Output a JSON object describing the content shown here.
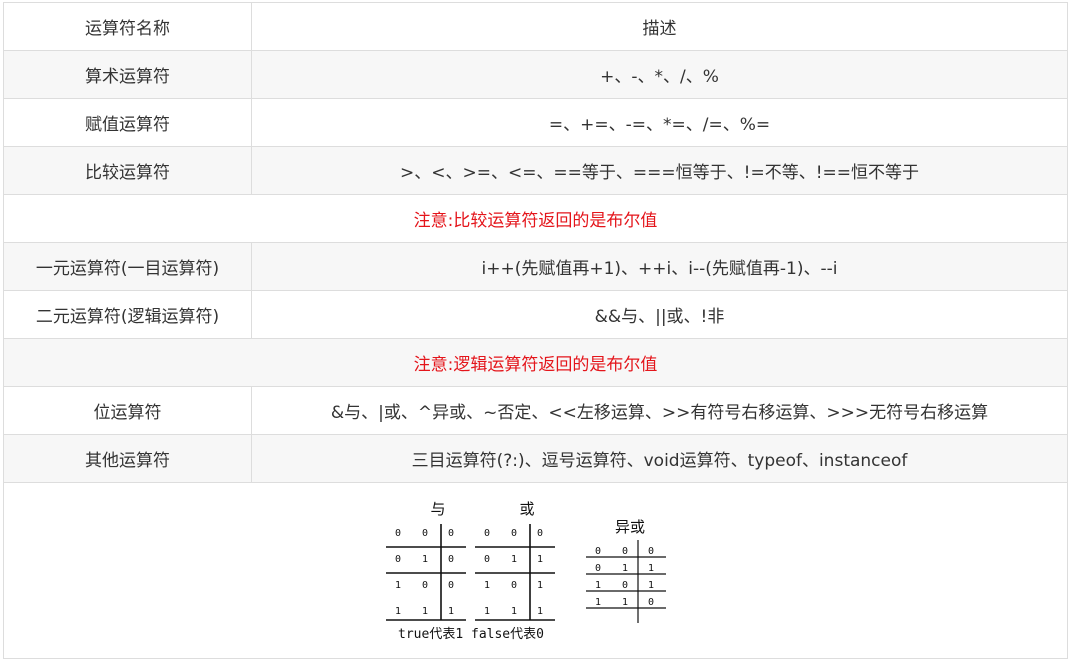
{
  "table": {
    "header": {
      "name": "运算符名称",
      "desc": "描述"
    },
    "rows": [
      {
        "name": "算术运算符",
        "desc": "+、-、*、/、%"
      },
      {
        "name": "赋值运算符",
        "desc": "=、+=、-=、*=、/=、%="
      },
      {
        "name": "比较运算符",
        "desc": ">、<、>=、<=、==等于、===恒等于、!=不等、!==恒不等于"
      },
      {
        "note": "注意:比较运算符返回的是布尔值"
      },
      {
        "name": "一元运算符(一目运算符)",
        "desc": "i++(先赋值再+1)、++i、i--(先赋值再-1)、--i"
      },
      {
        "name": "二元运算符(逻辑运算符)",
        "desc": "&&与、||或、!非"
      },
      {
        "note": "注意:逻辑运算符返回的是布尔值"
      },
      {
        "name": "位运算符",
        "desc": "&与、|或、^异或、~否定、<<左移运算、>>有符号右移运算、>>>无符号右移运算"
      },
      {
        "name": "其他运算符",
        "desc": "三目运算符(?:)、逗号运算符、void运算符、typeof、instanceof"
      }
    ]
  },
  "figure": {
    "and": {
      "title": "与",
      "rows": [
        [
          "0",
          "0",
          "0"
        ],
        [
          "0",
          "1",
          "0"
        ],
        [
          "1",
          "0",
          "0"
        ],
        [
          "1",
          "1",
          "1"
        ]
      ]
    },
    "or": {
      "title": "或",
      "rows": [
        [
          "0",
          "0",
          "0"
        ],
        [
          "0",
          "1",
          "1"
        ],
        [
          "1",
          "0",
          "1"
        ],
        [
          "1",
          "1",
          "1"
        ]
      ]
    },
    "xor": {
      "title": "异或",
      "rows": [
        [
          "0",
          "0",
          "0"
        ],
        [
          "0",
          "1",
          "1"
        ],
        [
          "1",
          "0",
          "1"
        ],
        [
          "1",
          "1",
          "0"
        ]
      ]
    },
    "caption": "true代表1 false代表0"
  }
}
